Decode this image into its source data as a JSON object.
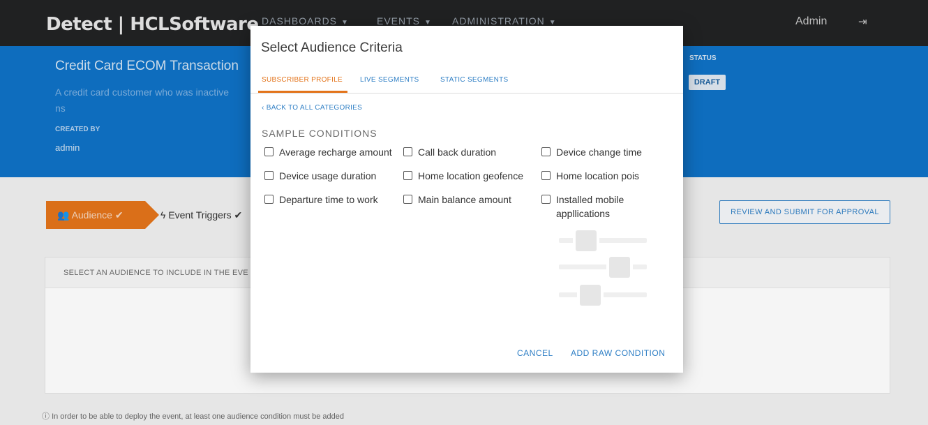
{
  "topbar": {
    "brand": "Detect | HCLSoftware",
    "nav": [
      "DASHBOARDS",
      "EVENTS",
      "ADMINISTRATION"
    ],
    "user": "Admin"
  },
  "header": {
    "title": "Credit Card ECOM Transaction",
    "description": "A credit card customer who was inactive",
    "description_wrap": "ns",
    "created_by_label": "CREATED BY",
    "created_by_value": "admin",
    "status_label": "STATUS",
    "status_value": "DRAFT"
  },
  "steps": {
    "audience": "Audience",
    "event_triggers": "Event Triggers"
  },
  "review_button": "REVIEW AND SUBMIT FOR APPROVAL",
  "panel": {
    "title": "SELECT AN AUDIENCE TO INCLUDE IN THE EVE"
  },
  "footer_note": "In order to be able to deploy the event, at least one audience condition must be added",
  "modal": {
    "title": "Select Audience Criteria",
    "tabs": [
      "SUBSCRIBER PROFILE",
      "LIVE SEGMENTS",
      "STATIC SEGMENTS"
    ],
    "back_link": "BACK TO ALL CATEGORIES",
    "section_title": "SAMPLE CONDITIONS",
    "conditions": [
      "Average recharge amount",
      "Call back duration",
      "Device change time",
      "Device usage duration",
      "Home location geofence",
      "Home location pois",
      "Departure time to work",
      "Main balance amount",
      "Installed mobile appllications"
    ],
    "cancel": "CANCEL",
    "add_raw": "ADD RAW CONDITION"
  },
  "colors": {
    "accent_orange": "#e3741b",
    "header_blue": "#0f72c6",
    "link_blue": "#2f7fc5"
  }
}
